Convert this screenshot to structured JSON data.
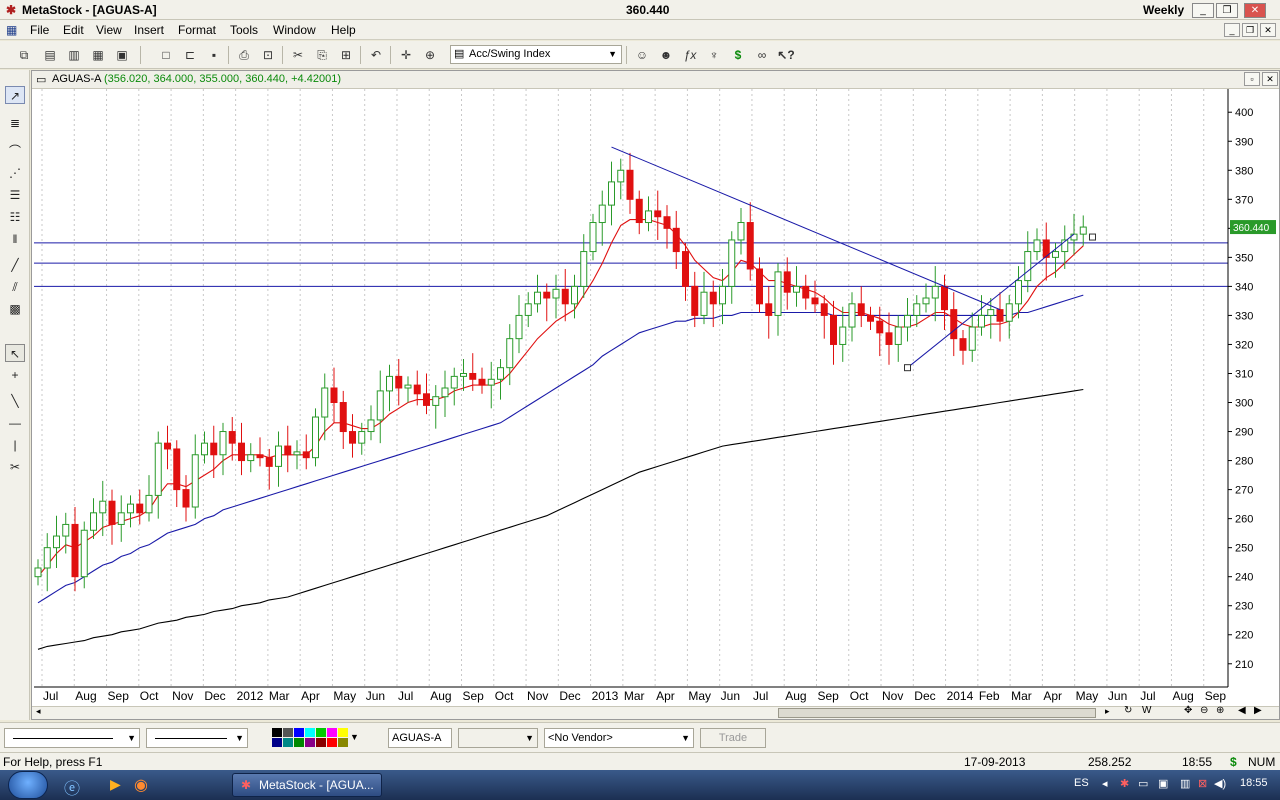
{
  "app": {
    "title": "MetaStock - [AGUAS-A]",
    "title_value": "360.440",
    "periodicity": "Weekly"
  },
  "menu": [
    "File",
    "Edit",
    "View",
    "Insert",
    "Format",
    "Tools",
    "Window",
    "Help"
  ],
  "toolbar": {
    "indicator_select": "Acc/Swing Index"
  },
  "chart": {
    "header": "AGUAS-A",
    "header_values": "(356.020, 364.000, 355.000, 360.440, +4.42001)",
    "last_price_label": "360.440"
  },
  "chart_data": {
    "type": "candlestick",
    "security": "AGUAS-A",
    "periodicity": "weekly",
    "y_ticks": [
      210,
      220,
      230,
      240,
      250,
      260,
      270,
      280,
      290,
      300,
      310,
      320,
      330,
      340,
      350,
      360,
      370,
      380,
      390,
      400
    ],
    "ylim": [
      202,
      408
    ],
    "x_tick_labels": [
      "Jul",
      "Aug",
      "Sep",
      "Oct",
      "Nov",
      "Dec",
      "2012",
      "Mar",
      "Apr",
      "May",
      "Jun",
      "Jul",
      "Aug",
      "Sep",
      "Oct",
      "Nov",
      "Dec",
      "2013",
      "Mar",
      "Apr",
      "May",
      "Jun",
      "Jul",
      "Aug",
      "Sep",
      "Oct",
      "Nov",
      "Dec",
      "2014",
      "Feb",
      "Mar",
      "Apr",
      "May",
      "Jun",
      "Jul",
      "Aug",
      "Sep"
    ],
    "close_series": [
      243,
      250,
      254,
      258,
      240,
      256,
      262,
      266,
      258,
      262,
      265,
      262,
      268,
      286,
      284,
      270,
      264,
      282,
      286,
      282,
      290,
      286,
      280,
      282,
      281,
      278,
      285,
      282,
      283,
      281,
      295,
      305,
      300,
      290,
      286,
      290,
      294,
      304,
      309,
      305,
      306,
      303,
      299,
      302,
      305,
      309,
      310,
      308,
      306,
      308,
      312,
      322,
      330,
      334,
      338,
      336,
      339,
      334,
      340,
      352,
      362,
      368,
      376,
      380,
      370,
      362,
      366,
      364,
      360,
      352,
      340,
      330,
      338,
      334,
      340,
      356,
      362,
      346,
      334,
      330,
      345,
      338,
      340,
      336,
      334,
      330,
      320,
      326,
      334,
      330,
      328,
      324,
      320,
      326,
      330,
      334,
      336,
      340,
      332,
      322,
      318,
      326,
      330,
      332,
      328,
      334,
      342,
      352,
      356,
      350,
      352,
      356,
      358,
      360.44
    ],
    "ma_short": [
      240,
      244,
      248,
      251,
      250,
      252,
      254,
      257,
      258,
      259,
      260,
      261,
      263,
      268,
      272,
      272,
      271,
      273,
      275,
      277,
      280,
      282,
      282,
      282,
      282,
      281,
      282,
      282,
      282,
      282,
      285,
      290,
      293,
      293,
      292,
      291,
      291,
      293,
      296,
      298,
      300,
      301,
      301,
      301,
      302,
      304,
      305,
      306,
      306,
      306,
      307,
      310,
      314,
      318,
      322,
      325,
      328,
      330,
      332,
      337,
      342,
      348,
      355,
      361,
      363,
      363,
      363,
      362,
      361,
      358,
      354,
      349,
      346,
      343,
      342,
      345,
      349,
      348,
      345,
      342,
      342,
      341,
      340,
      339,
      338,
      336,
      333,
      331,
      331,
      331,
      330,
      329,
      327,
      326,
      326,
      327,
      329,
      331,
      331,
      329,
      327,
      326,
      326,
      327,
      327,
      328,
      331,
      335,
      340,
      343,
      345,
      348,
      351,
      354
    ],
    "ma_medium": [
      231,
      233,
      235,
      237,
      238,
      240,
      242,
      244,
      245,
      247,
      248,
      250,
      251,
      253,
      255,
      256,
      257,
      258,
      260,
      261,
      263,
      264,
      265,
      266,
      267,
      268,
      269,
      270,
      271,
      272,
      273,
      274,
      275,
      276,
      277,
      278,
      279,
      280,
      281,
      282,
      283,
      284,
      285,
      286,
      287,
      288,
      289,
      290,
      291,
      292,
      293,
      295,
      297,
      299,
      301,
      303,
      305,
      307,
      309,
      311,
      313,
      316,
      318,
      320,
      322,
      324,
      325,
      326,
      327,
      328,
      328,
      329,
      329,
      329,
      330,
      330,
      331,
      331,
      331,
      331,
      331,
      331,
      331,
      331,
      331,
      331,
      330,
      330,
      330,
      330,
      330,
      330,
      330,
      330,
      330,
      330,
      330,
      330,
      330,
      330,
      330,
      330,
      330,
      330,
      330,
      330,
      331,
      331,
      332,
      333,
      334,
      335,
      336,
      337
    ],
    "ma_long": [
      215,
      216,
      216.5,
      217,
      217.5,
      218,
      219,
      219.5,
      220,
      221,
      221.5,
      222,
      223,
      224,
      224.5,
      225,
      226,
      226.5,
      227,
      228,
      228.5,
      229,
      230,
      230.5,
      231,
      232,
      232.5,
      233,
      234,
      235,
      236,
      237,
      238,
      239,
      240,
      241,
      242,
      243,
      244,
      245,
      246,
      247,
      248,
      249,
      250,
      251,
      252,
      253,
      254,
      255,
      256,
      257,
      258,
      259,
      260,
      261,
      262.5,
      264,
      265.5,
      267,
      268.5,
      270,
      271.5,
      273,
      274.5,
      276,
      277,
      278,
      279,
      280,
      281,
      282,
      283,
      284,
      285,
      285.5,
      286,
      286.5,
      287,
      287.5,
      288,
      288.5,
      289,
      289.5,
      290,
      290.5,
      291,
      291.5,
      292,
      292.5,
      293,
      293.5,
      294,
      294.5,
      295,
      295.5,
      296,
      296.5,
      297,
      297.5,
      298,
      298.5,
      299,
      299.5,
      300,
      300.5,
      301,
      301.5,
      302,
      302.5,
      303,
      303.5,
      304,
      304.5
    ],
    "horizontal_lines": [
      355,
      348,
      340
    ],
    "trendlines": [
      {
        "from": [
          62,
          388
        ],
        "to": [
          104,
          332
        ]
      },
      {
        "from": [
          94,
          312
        ],
        "to": [
          112,
          358
        ]
      }
    ],
    "grid": true
  },
  "bottom": {
    "line_style_1": "",
    "line_style_2": "",
    "security_field": "AGUAS-A",
    "vendor_select": "<No Vendor>",
    "trade_button": "Trade"
  },
  "status": {
    "help": "For Help, press F1",
    "date": "17-09-2013",
    "value": "258.252",
    "time": "18:55",
    "dollar": "$",
    "num": "NUM"
  },
  "taskbar": {
    "task_item": "MetaStock - [AGUA...",
    "lang": "ES",
    "clock": "18:55"
  },
  "colors": {
    "up_candle": "#2a9a2a",
    "down_candle": "#e01010",
    "ma_short": "#e01010",
    "ma_medium": "#1a1aa8",
    "ma_long": "#000000",
    "hlines": "#1a1aa8"
  }
}
